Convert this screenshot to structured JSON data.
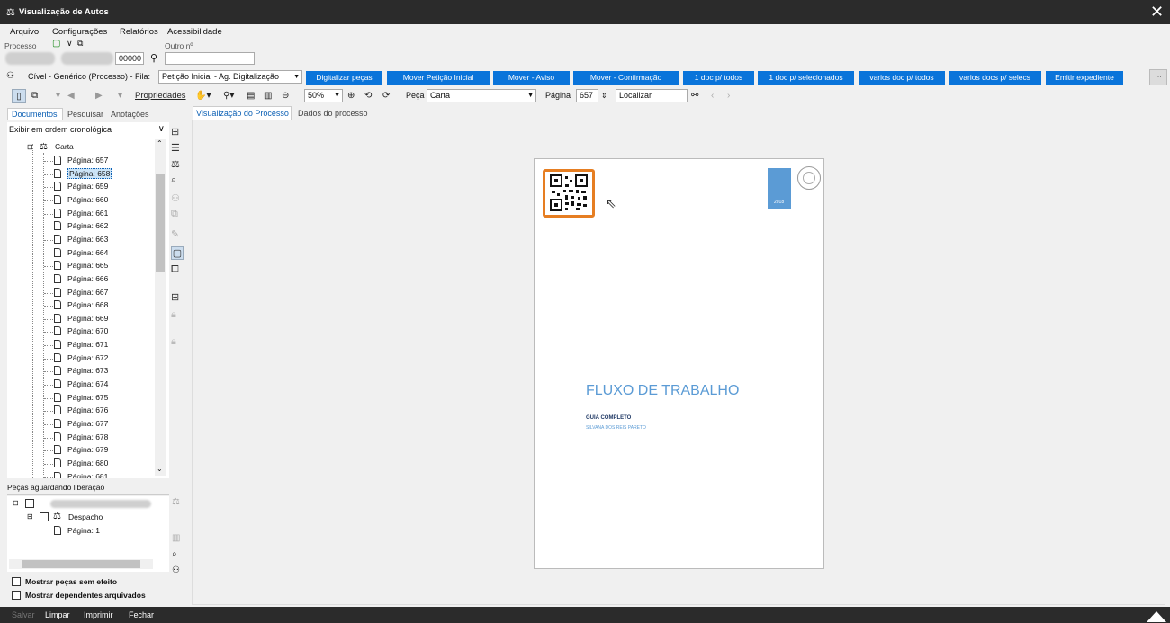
{
  "window": {
    "title": "Visualização de Autos",
    "close_glyph": "✕"
  },
  "menu": [
    "Arquivo",
    "Configurações",
    "Relatórios",
    "Acessibilidade"
  ],
  "process": {
    "label": "Processo",
    "number_suffix": "00000",
    "other_label": "Outro nº"
  },
  "queue": {
    "text": "Cível - Genérico (Processo) - Fila:",
    "selected": "Petição Inicial - Ag. Digitalização"
  },
  "action_buttons": [
    "Digitalizar peças",
    "Mover Petição Inicial",
    "Mover - Aviso",
    "Mover - Confirmação",
    "1 doc p/ todos",
    "1 doc p/ selecionados",
    "varios doc p/ todos",
    "varios docs p/ selecs",
    "Emitir expediente"
  ],
  "more_button": "...",
  "toolbar": {
    "properties": "Propriedades",
    "zoom": "50%",
    "piece_label": "Peça",
    "piece_value": "Carta",
    "page_label": "Página",
    "page_value": "657",
    "find_placeholder": "Localizar"
  },
  "left_tabs": [
    "Documentos",
    "Pesquisar",
    "Anotações"
  ],
  "order_select": "Exibir em ordem cronológica",
  "tree": {
    "doc": "Carta",
    "pages": [
      "Página: 657",
      "Página: 658",
      "Página: 659",
      "Página: 660",
      "Página: 661",
      "Página: 662",
      "Página: 663",
      "Página: 664",
      "Página: 665",
      "Página: 666",
      "Página: 667",
      "Página: 668",
      "Página: 669",
      "Página: 670",
      "Página: 671",
      "Página: 672",
      "Página: 673",
      "Página: 674",
      "Página: 675",
      "Página: 676",
      "Página: 677",
      "Página: 678",
      "Página: 679",
      "Página: 680",
      "Página: 681"
    ],
    "selected_index": 1
  },
  "pending": {
    "title": "Peças aguardando liberação",
    "doc": "Despacho",
    "page": "Página: 1"
  },
  "checkboxes": {
    "no_effect": "Mostrar peças sem efeito",
    "archived": "Mostrar dependentes arquivados"
  },
  "view_tabs": [
    "Visualização do Processo",
    "Dados do processo"
  ],
  "document": {
    "title": "FLUXO DE TRABALHO",
    "subtitle": "GUIA COMPLETO",
    "author": "SILVANA DOS REIS PARETO",
    "year": "2018"
  },
  "bottom": [
    "Salvar",
    "Limpar",
    "Imprimir",
    "Fechar"
  ],
  "colors": {
    "accent": "#0a74da",
    "title_blue": "#5b9bd5",
    "qr_border": "#e67e22"
  }
}
